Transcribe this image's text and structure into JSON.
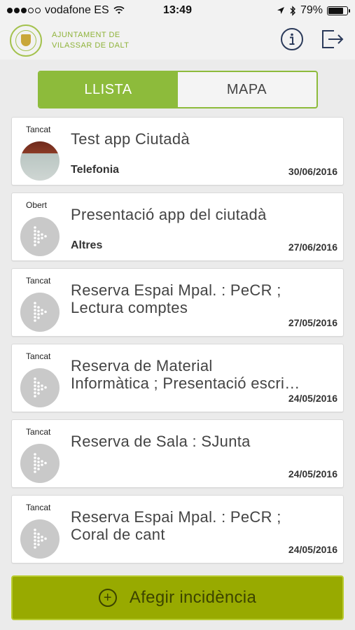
{
  "status_bar": {
    "carrier": "vodafone ES",
    "time": "13:49",
    "battery": "79%",
    "battery_level": 0.79,
    "signal_bars": 3,
    "icons": [
      "wifi-icon",
      "location-arrow-icon",
      "bluetooth-icon",
      "battery-icon"
    ]
  },
  "header": {
    "org_line1": "AJUNTAMENT DE",
    "org_line2": "VILASSAR DE DALT",
    "icons": [
      "info-icon",
      "logout-icon"
    ]
  },
  "tabs": [
    {
      "label": "LLISTA",
      "active": true
    },
    {
      "label": "MAPA",
      "active": false
    }
  ],
  "items": [
    {
      "status": "Tancat",
      "title_line1": "Test app Ciutadà",
      "title_line2": "",
      "category": "Telefonia",
      "date": "30/06/2016",
      "thumb": "photo"
    },
    {
      "status": "Obert",
      "title_line1": "Presentació app del ciutadà",
      "title_line2": "",
      "category": "Altres",
      "date": "27/06/2016",
      "thumb": "arrow"
    },
    {
      "status": "Tancat",
      "title_line1": "Reserva Espai Mpal. : PeCR ;",
      "title_line2": "Lectura comptes",
      "category": "",
      "date": "27/05/2016",
      "thumb": "arrow"
    },
    {
      "status": "Tancat",
      "title_line1": "Reserva de Material",
      "title_line2": "Informàtica ; Presentació escri…",
      "category": "",
      "date": "24/05/2016",
      "thumb": "arrow"
    },
    {
      "status": "Tancat",
      "title_line1": "Reserva de Sala : SJunta",
      "title_line2": "",
      "category": "",
      "date": "24/05/2016",
      "thumb": "arrow"
    },
    {
      "status": "Tancat",
      "title_line1": "Reserva Espai Mpal. : PeCR ;",
      "title_line2": "Coral de cant",
      "category": "",
      "date": "24/05/2016",
      "thumb": "arrow"
    }
  ],
  "add_button": {
    "label": "Afegir incidència",
    "icon": "plus-circle-icon"
  },
  "colors": {
    "accent": "#8dbb3b",
    "add_button": "#98aa00",
    "logo_text": "#8fb33a"
  }
}
